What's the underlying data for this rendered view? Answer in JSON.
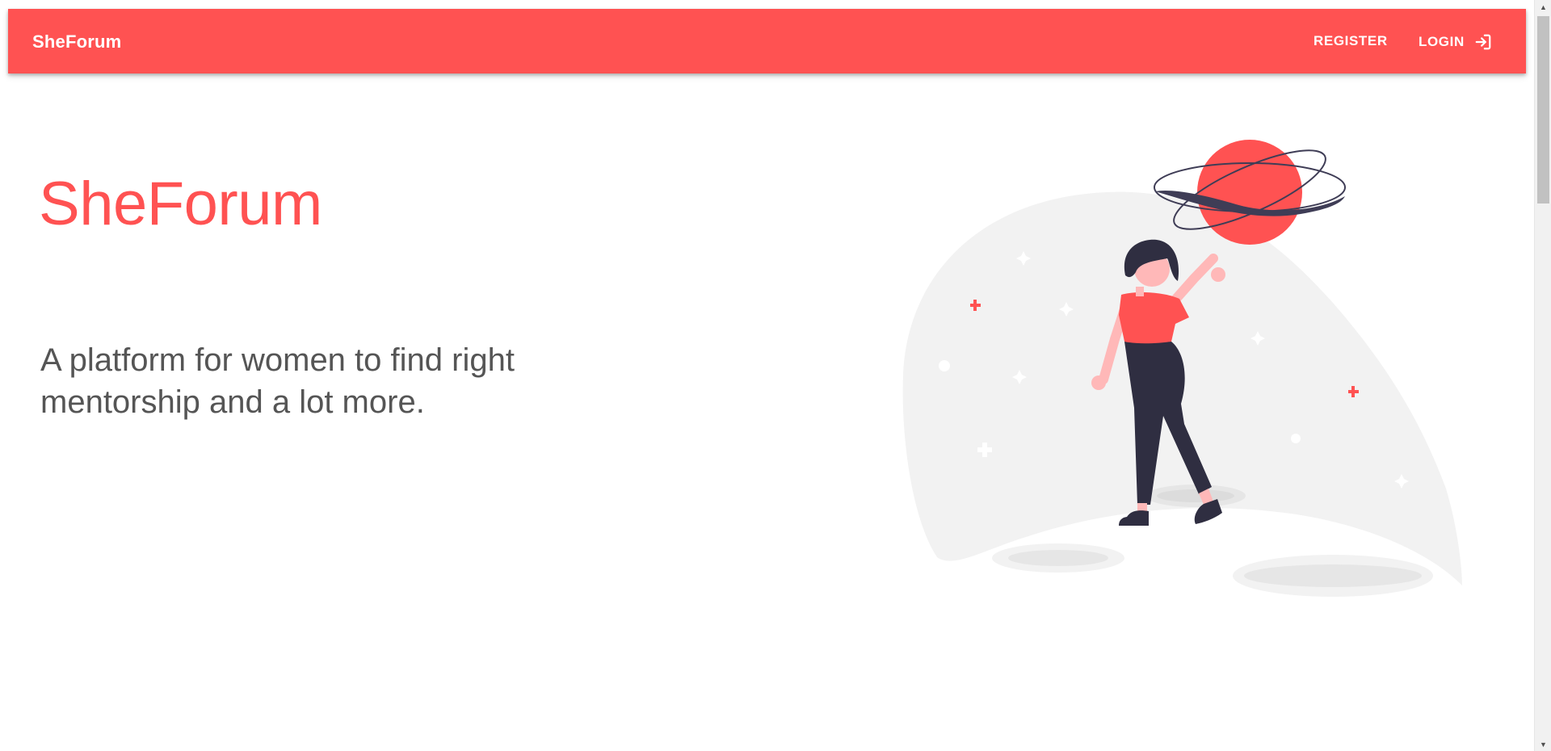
{
  "navbar": {
    "brand": "SheForum",
    "register_label": "REGISTER",
    "login_label": "LOGIN",
    "login_icon": "login-icon",
    "background": "#ff5252"
  },
  "hero": {
    "title": "SheForum",
    "subtitle": "A platform for women to find right mentorship and a lot more."
  },
  "colors": {
    "accent": "#ff5252",
    "text_muted": "#555555",
    "illustration_dark": "#2f2e41",
    "illustration_skin": "#ffb8b8",
    "illustration_bg": "#f2f2f2"
  },
  "illustration": {
    "name": "woman-with-planet-illustration"
  }
}
